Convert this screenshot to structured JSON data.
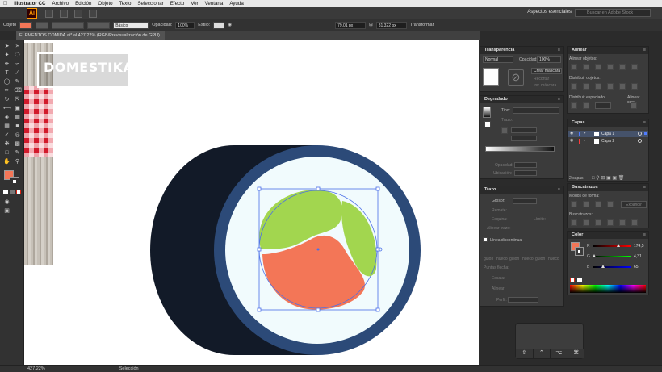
{
  "menubar": {
    "app_name": "Illustrator CC",
    "items": [
      "Archivo",
      "Edición",
      "Objeto",
      "Texto",
      "Seleccionar",
      "Efecto",
      "Ver",
      "Ventana",
      "Ayuda"
    ]
  },
  "appbar": {
    "logo": "Ai",
    "workspace": "Aspectos esenciales",
    "stock_placeholder": "Buscar en Adobe Stock"
  },
  "control_bar": {
    "selection_label": "Objeto",
    "stroke_style": "Básico",
    "opacity_label": "Opacidad:",
    "opacity_value": "100%",
    "style_label": "Estilo:",
    "width_value": "79,01 px",
    "height_value": "81,322 px",
    "transform_label": "Transformar"
  },
  "document_tab": {
    "label": "ELEMENTOS COMIDA.ai* al 427,22% (RGB/Previsualización de GPU)"
  },
  "overlay_logo": "DOMESTIKA",
  "status": {
    "zoom": "427,22%",
    "tool": "Selección"
  },
  "transparency_panel": {
    "title": "Transparencia",
    "mode": "Normal",
    "opacity_label": "Opacidad:",
    "opacity_value": "100%",
    "mask_button": "Crear máscara",
    "clip": "Recortar",
    "invert": "Inv. máscara"
  },
  "gradient_panel": {
    "title": "Degradado",
    "type_label": "Tipo:",
    "stroke_label": "Trazo:",
    "opacity_label": "Opacidad:",
    "location_label": "Ubicación:"
  },
  "stroke_panel": {
    "title": "Trazo",
    "weight_label": "Grosor:",
    "cap_label": "Remate:",
    "corner_label": "Esquina:",
    "limit_label": "Límite:",
    "align_label": "Alinear trazo:",
    "dashed_label": "Línea discontinua",
    "dash_labels": [
      "guión",
      "hueco",
      "guión",
      "hueco",
      "guión",
      "hueco"
    ],
    "arrow_label": "Puntas flecha:",
    "scale_label": "Escala:",
    "align2_label": "Alinear:",
    "profile_label": "Perfil:"
  },
  "align_panel": {
    "title": "Alinear",
    "align_objects": "Alinear objetos:",
    "distribute_objects": "Distribuir objetos:",
    "distribute_spacing": "Distribuir espaciado:",
    "align_to": "Alinear con:"
  },
  "layers_panel": {
    "title": "Capas",
    "layers": [
      {
        "name": "Capa 1",
        "color": "#4f7cff"
      },
      {
        "name": "Capa 2",
        "color": "#ff3b3b"
      }
    ],
    "count": "2 capas"
  },
  "pathfinder_panel": {
    "title": "Buscatrazos",
    "shape_modes": "Modos de forma:",
    "expand": "Expandir",
    "pathfinders": "Buscatrazos:"
  },
  "color_panel": {
    "title": "Color",
    "channels": [
      {
        "label": "R",
        "value": "174,5",
        "level": 0.68
      },
      {
        "label": "G",
        "value": "4,31",
        "level": 0.02
      },
      {
        "label": "B",
        "value": "65",
        "level": 0.25
      }
    ]
  },
  "artwork": {
    "colors": {
      "shadow": "#121a28",
      "rim": "#2c4a78",
      "rice": "#f1fbfd",
      "green": "#a2d64f",
      "salmon": "#f37657",
      "selection": "#4b6fe8"
    }
  }
}
